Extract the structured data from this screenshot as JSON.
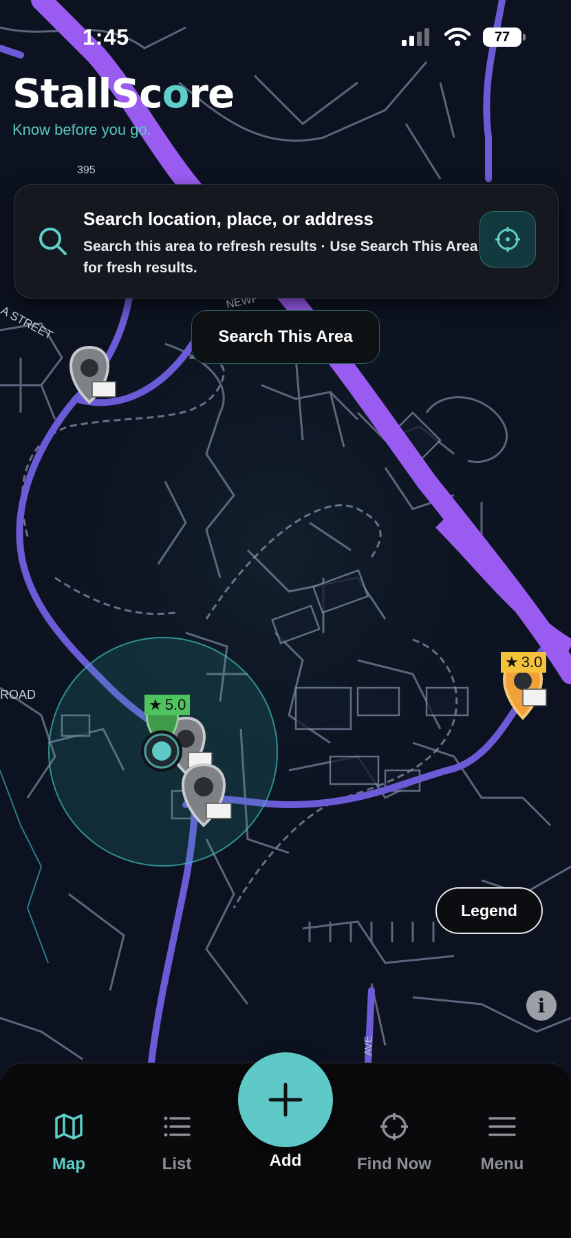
{
  "status_bar": {
    "time": "1:45",
    "battery": "77",
    "icons": [
      "cellular-signal-icon",
      "wifi-icon",
      "battery-icon"
    ]
  },
  "brand": {
    "name_part1": "StallSc",
    "name_accent": "o",
    "name_part2": "re",
    "tagline": "Know before you go."
  },
  "search": {
    "title": "Search location, place, or address",
    "subtitle": "Search this area to refresh results · Use Search This Area for fresh results.",
    "icon": "search-icon",
    "locate_icon": "crosshair-icon"
  },
  "map": {
    "search_area_button": "Search This Area",
    "legend_button": "Legend",
    "info_icon": "i",
    "road_labels": {
      "route": "395",
      "street": "A STREET",
      "road": "ROAD",
      "newport": "NEWP",
      "ave": "AVE"
    },
    "ratings": [
      {
        "star": "★",
        "value": "5.0",
        "color": "#4ec35f"
      },
      {
        "star": "★",
        "value": "3.0",
        "color": "#f3c23a"
      }
    ],
    "colors": {
      "background": "#0c1220",
      "highway": "#9a5cf0",
      "main_road": "#6b5bd6",
      "local_road": "#7d8aa3",
      "accent": "#5fcfc9"
    }
  },
  "tabbar": {
    "tabs": [
      {
        "label": "Map",
        "icon": "map-icon",
        "active": true
      },
      {
        "label": "List",
        "icon": "list-icon",
        "active": false
      },
      {
        "label": "Add",
        "icon": "plus-icon",
        "active": false
      },
      {
        "label": "Find Now",
        "icon": "crosshair-icon",
        "active": false
      },
      {
        "label": "Menu",
        "icon": "hamburger-menu-icon",
        "active": false
      }
    ]
  }
}
